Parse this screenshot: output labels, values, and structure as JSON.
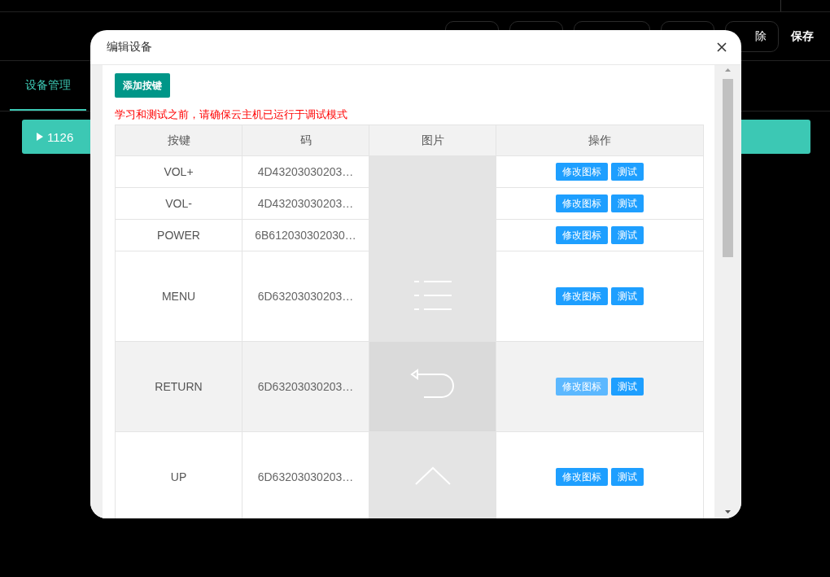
{
  "toolbar": {
    "delete": "除",
    "save": "保存"
  },
  "tabs": [
    {
      "label": "设备管理",
      "selected": true
    }
  ],
  "tree": [
    {
      "label": "1126",
      "expanded": false
    }
  ],
  "dialog": {
    "title": "编辑设备",
    "add_button": "添加按键",
    "warning": "学习和测试之前，请确保云主机已运行于调试模式",
    "columns": [
      "按键",
      "码",
      "图片",
      "操作"
    ],
    "rows": [
      {
        "key": "VOL+",
        "code": "4D43203030203…",
        "kind": "plain",
        "highlighted": false,
        "actions": [
          "修改图标",
          "测试"
        ]
      },
      {
        "key": "VOL-",
        "code": "4D43203030203…",
        "kind": "plain",
        "highlighted": false,
        "actions": [
          "修改图标",
          "测试"
        ]
      },
      {
        "key": "POWER",
        "code": "6B612030302030…",
        "kind": "plain",
        "highlighted": false,
        "actions": [
          "修改图标",
          "测试"
        ]
      },
      {
        "key": "MENU",
        "code": "6D63203030203…",
        "kind": "menu",
        "highlighted": false,
        "actions": [
          "修改图标",
          "测试"
        ]
      },
      {
        "key": "RETURN",
        "code": "6D63203030203…",
        "kind": "return",
        "highlighted": true,
        "actions": [
          "修改图标",
          "测试"
        ]
      },
      {
        "key": "UP",
        "code": "6D63203030203…",
        "kind": "up",
        "highlighted": false,
        "actions": [
          "修改图标",
          "测试"
        ]
      }
    ]
  }
}
